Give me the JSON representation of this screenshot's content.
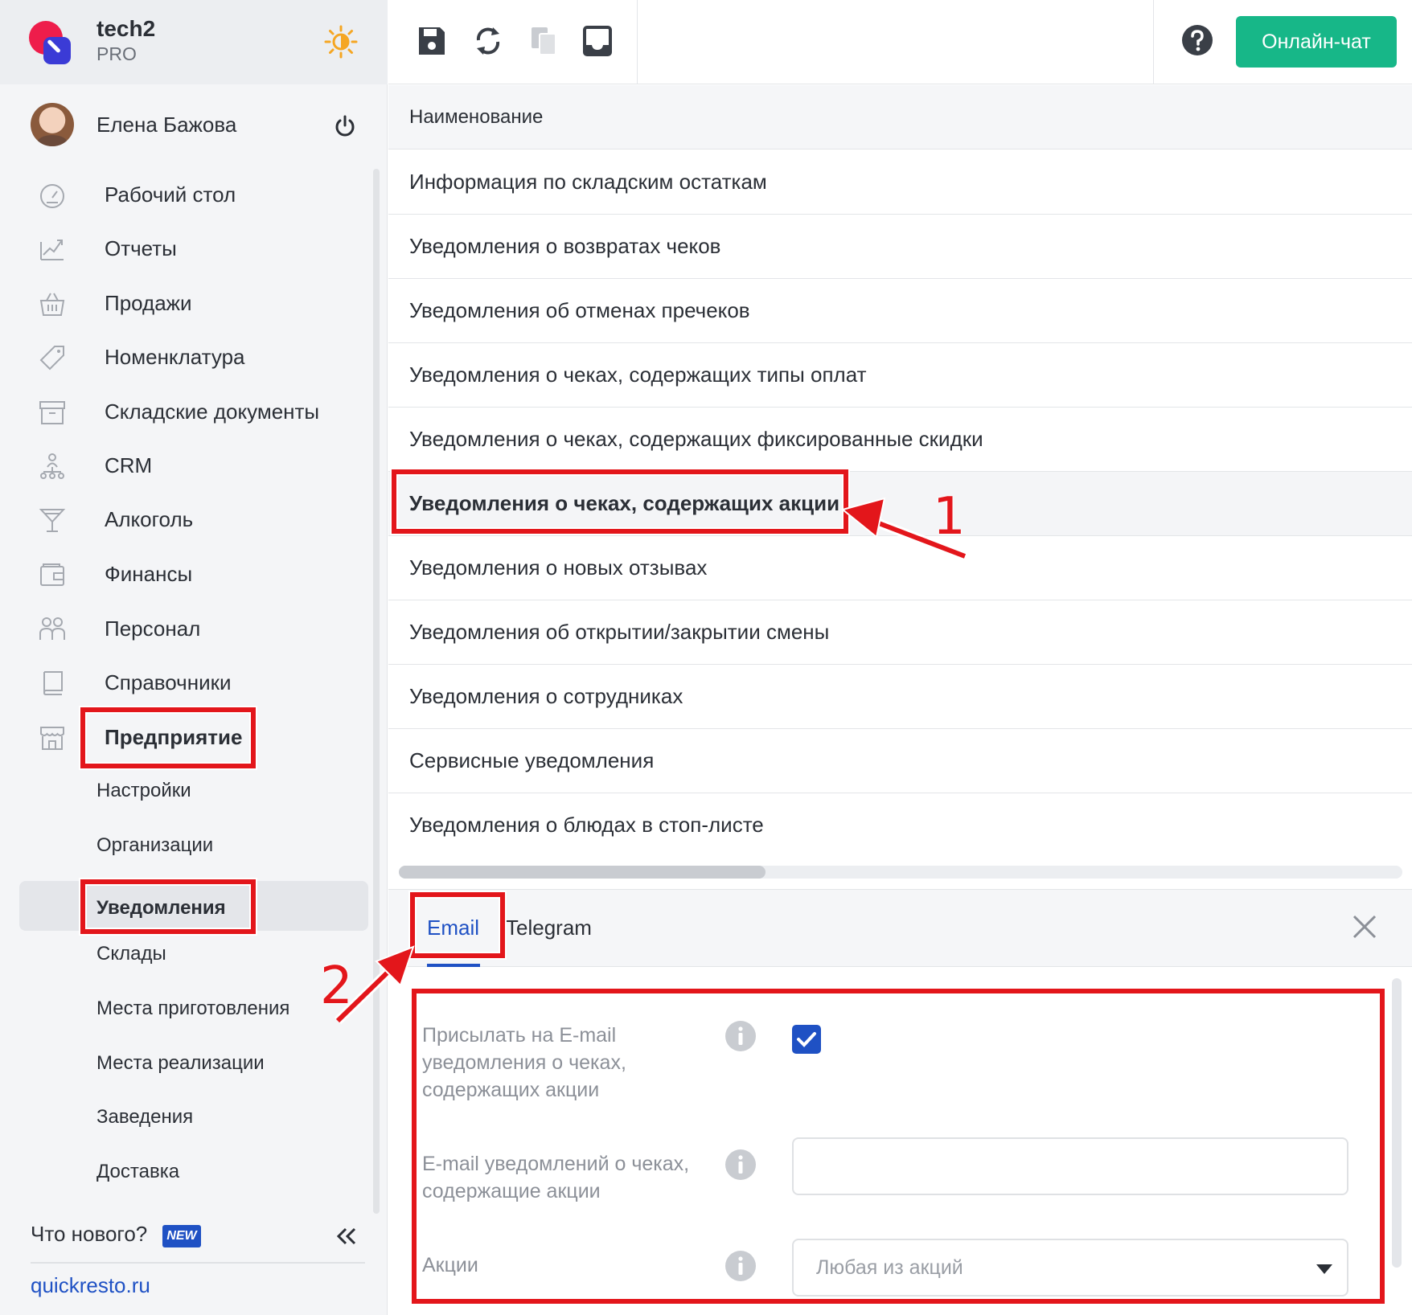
{
  "app": {
    "name": "tech2",
    "plan": "PRO"
  },
  "user": {
    "name": "Елена Бажова"
  },
  "nav": [
    {
      "label": "Рабочий стол",
      "icon": "dashboard-icon"
    },
    {
      "label": "Отчеты",
      "icon": "reports-icon"
    },
    {
      "label": "Продажи",
      "icon": "sales-basket-icon"
    },
    {
      "label": "Номенклатура",
      "icon": "tag-icon"
    },
    {
      "label": "Складские документы",
      "icon": "archive-icon"
    },
    {
      "label": "CRM",
      "icon": "crm-icon"
    },
    {
      "label": "Алкоголь",
      "icon": "cocktail-icon"
    },
    {
      "label": "Финансы",
      "icon": "wallet-icon"
    },
    {
      "label": "Персонал",
      "icon": "staff-icon"
    },
    {
      "label": "Справочники",
      "icon": "book-icon"
    },
    {
      "label": "Предприятие",
      "icon": "store-icon"
    }
  ],
  "subnav": [
    {
      "label": "Настройки"
    },
    {
      "label": "Организации"
    },
    {
      "label": "Уведомления"
    },
    {
      "label": "Склады"
    },
    {
      "label": "Места приготовления"
    },
    {
      "label": "Места реализации"
    },
    {
      "label": "Заведения"
    },
    {
      "label": "Доставка"
    }
  ],
  "sidebar_footer": {
    "whats_new": "Что нового?",
    "badge": "NEW",
    "site": "quickresto.ru"
  },
  "toolbar": {
    "buttons": [
      "save-icon",
      "refresh-icon",
      "copy-icon",
      "inbox-icon"
    ],
    "chat_label": "Онлайн-чат"
  },
  "list": {
    "header": "Наименование",
    "rows": [
      "Информация по складским остаткам",
      "Уведомления о возвратах чеков",
      "Уведомления об отменах пречеков",
      "Уведомления о чеках, содержащих типы оплат",
      "Уведомления о чеках, содержащих фиксированные скидки",
      "Уведомления о чеках, содержащих акции",
      "Уведомления о новых отзывах",
      "Уведомления об открытии/закрытии смены",
      "Уведомления о сотрудниках",
      "Сервисные уведомления",
      "Уведомления о блюдах в стоп-листе"
    ],
    "selected_index": 5
  },
  "panel": {
    "tabs": [
      "Email",
      "Telegram"
    ],
    "active_tab": "Email",
    "send_email_label": "Присылать на E-mail уведомления о чеках, содержащих акции",
    "send_email_checked": true,
    "email_label": "E-mail уведомлений о чеках, содержащие акции",
    "email_value": "",
    "promos_label": "Акции",
    "promos_value": "Любая из акций"
  },
  "annotations": {
    "step1": "1",
    "step2": "2"
  },
  "colors": {
    "accent": "#1f51c4",
    "chat": "#17b788",
    "highlight": "#e3161b"
  }
}
